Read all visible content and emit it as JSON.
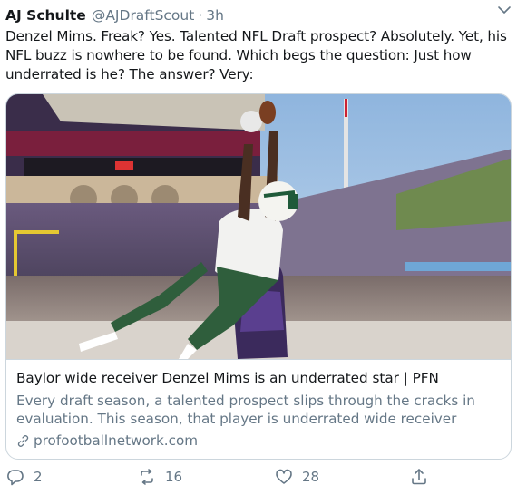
{
  "tweet": {
    "display_name": "AJ Schulte",
    "handle": "@AJDraftScout",
    "separator": "·",
    "time": "3h",
    "text": "Denzel Mims. Freak? Yes. Talented NFL Draft prospect? Absolutely. Yet, his NFL buzz is nowhere to be found. Which begs the question: Just how underrated is he? The answer? Very:"
  },
  "card": {
    "title": "Baylor wide receiver Denzel Mims is an underrated star | PFN",
    "description": "Every draft season, a talented prospect slips through the cracks in evaluation. This season, that player is underrated wide receiver Denzel ...",
    "domain": "profootballnetwork.com",
    "image_icon": "football-catch-photo"
  },
  "actions": {
    "reply_count": "2",
    "retweet_count": "16",
    "like_count": "28"
  },
  "colors": {
    "text_primary": "#14171a",
    "text_secondary": "#657786",
    "border": "#ccd6dd",
    "baylor_green": "#1f5a3a",
    "opponent_purple": "#4b2e83",
    "sky": "#a9c6e3"
  }
}
